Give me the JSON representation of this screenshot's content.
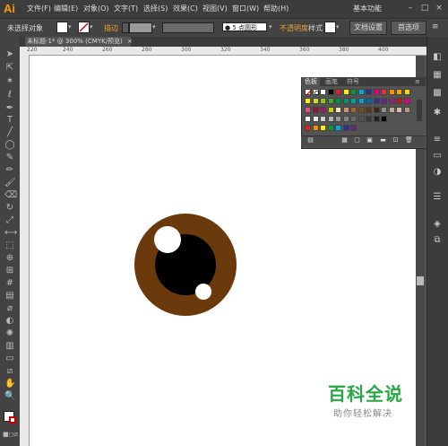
{
  "app": {
    "logo": "Ai",
    "workspace": "基本功能",
    "menu": [
      "文件(F)",
      "编辑(E)",
      "对象(O)",
      "文字(T)",
      "选择(S)",
      "效果(C)",
      "视图(V)",
      "窗口(W)",
      "帮助(H)"
    ],
    "window_controls": [
      "–",
      "□",
      "×"
    ]
  },
  "controlbar": {
    "selection": "未选择对象",
    "stroke_label": "描边",
    "stroke_value": "",
    "brush_label": "5 点圆形",
    "opacity_label": "不透明度",
    "style_label": "样式",
    "doc_settings": "文档设置",
    "preferences": "首选项"
  },
  "document": {
    "tab_title": "未标题-1* @ 300% (CMYK/预览)",
    "tab_close": "×"
  },
  "ruler": {
    "h_ticks": [
      "220",
      "240",
      "260",
      "280",
      "300",
      "320",
      "340",
      "360",
      "380",
      "400"
    ]
  },
  "swatches_panel": {
    "tabs": [
      "色板",
      "画笔",
      "符号"
    ],
    "active_tab": "色板"
  },
  "watermark": {
    "title": "百科全说",
    "subtitle": "助你轻松解决"
  },
  "eye": {
    "iris_color": "#6b3a0c",
    "pupil_color": "#000000",
    "highlight_color": "#ffffff"
  }
}
